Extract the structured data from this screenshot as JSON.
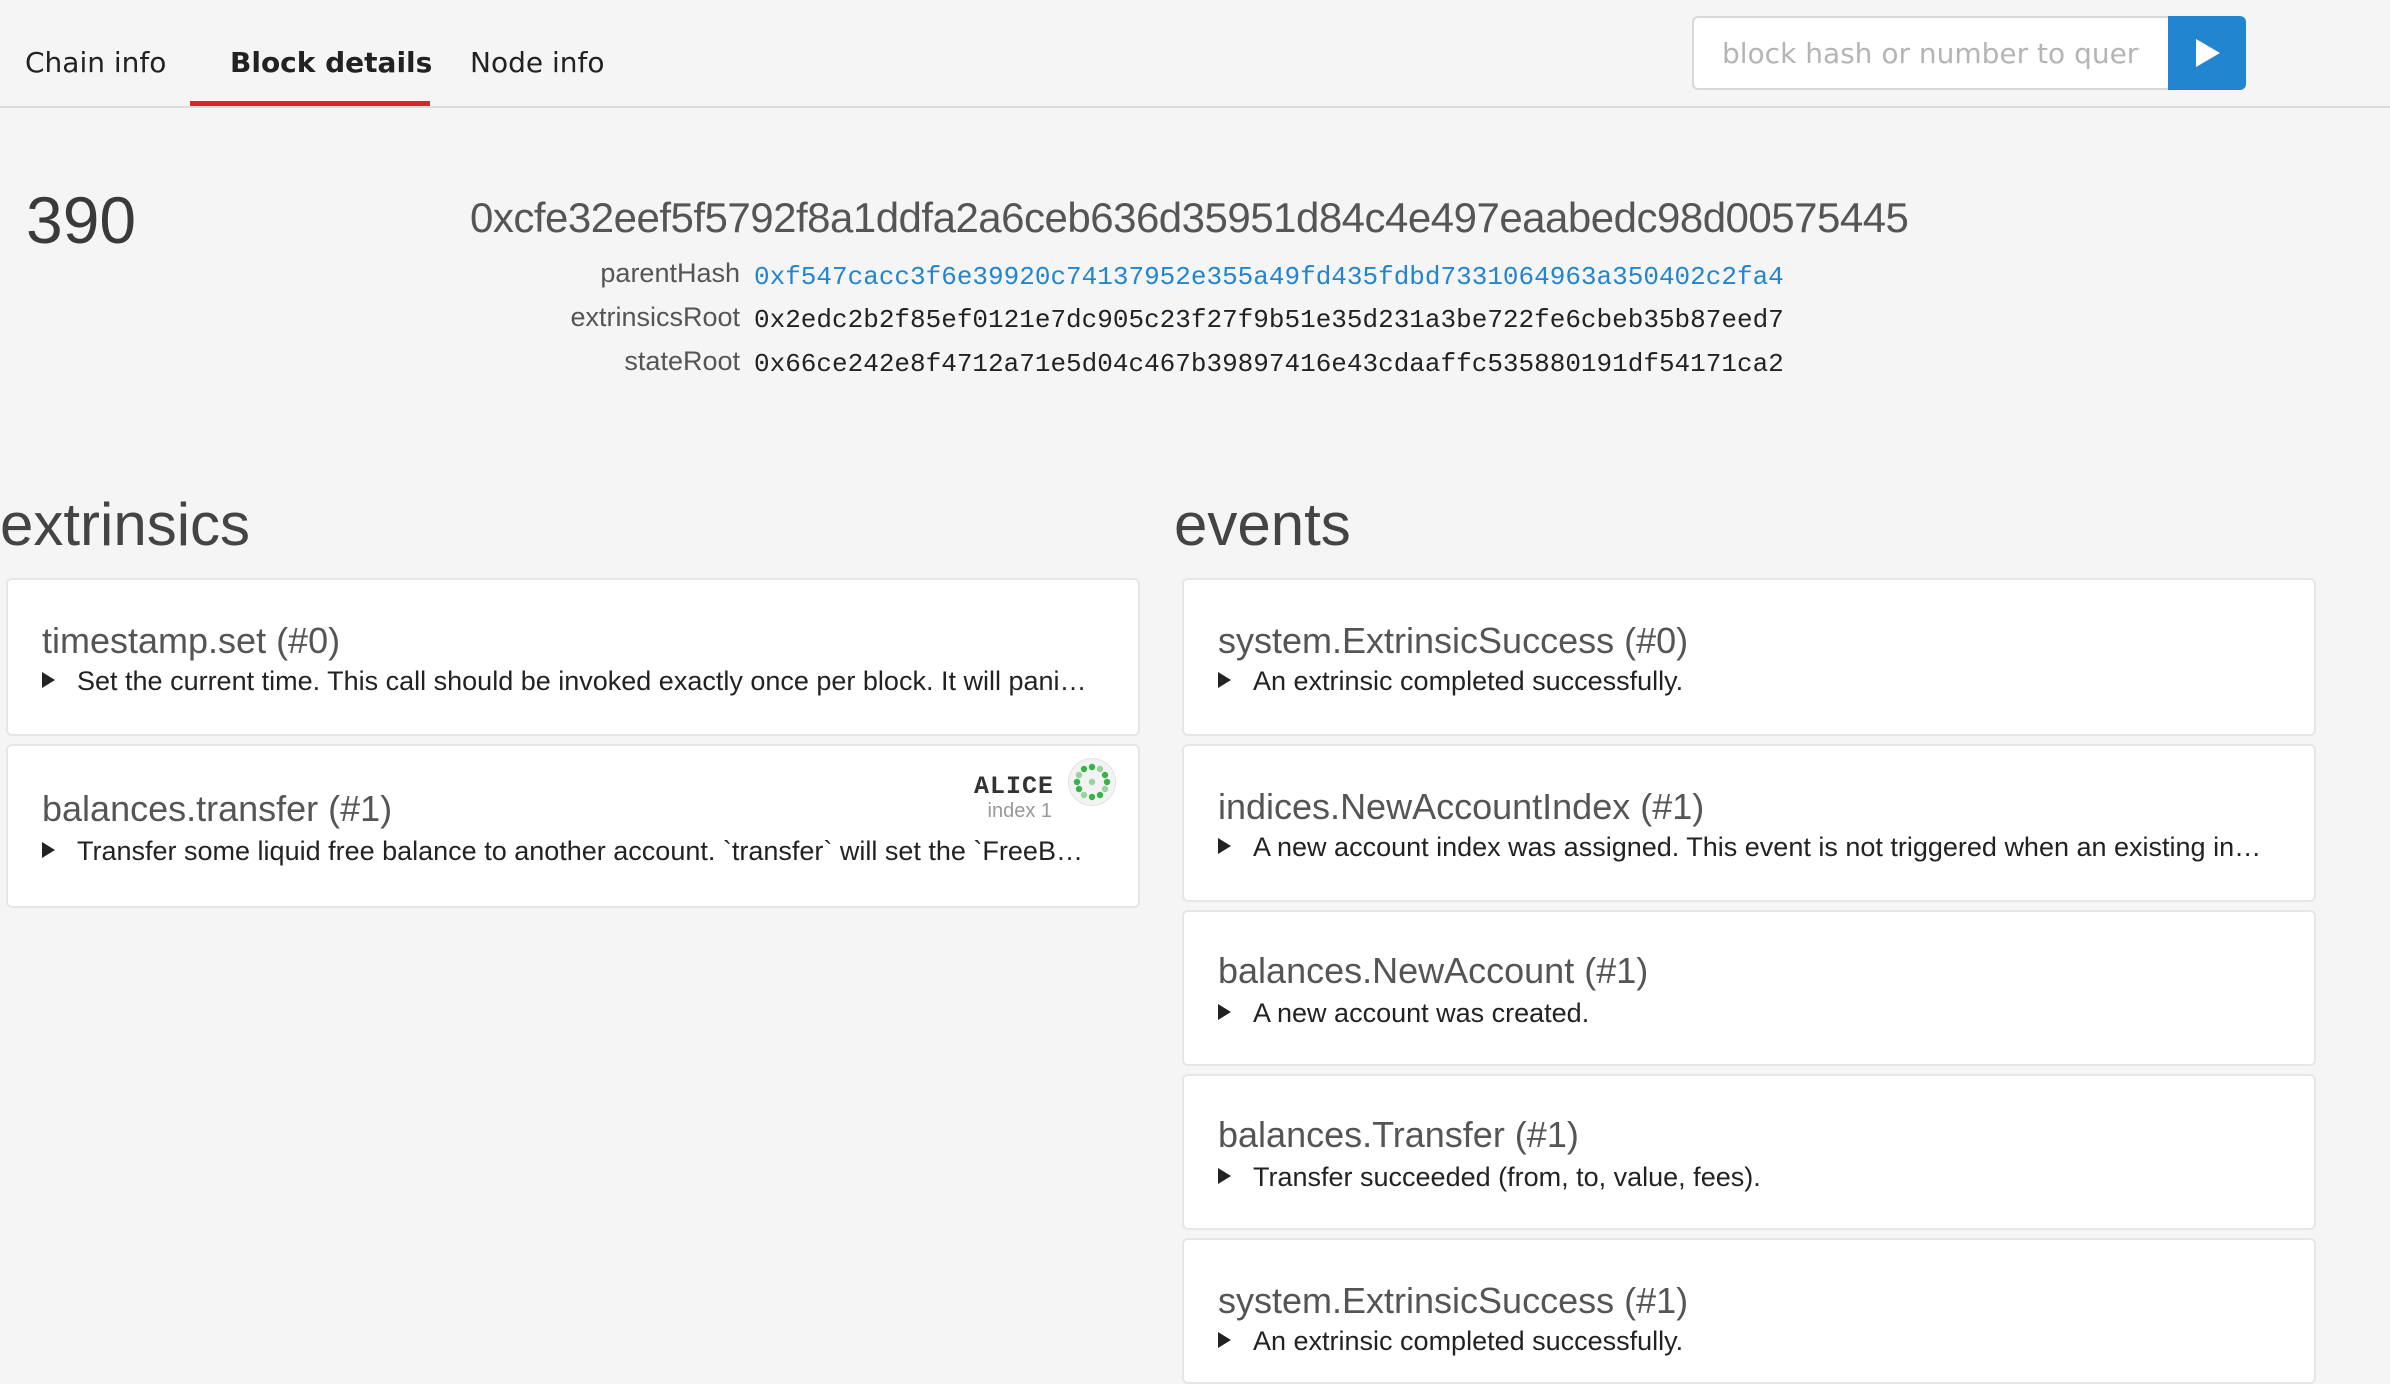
{
  "tabs": [
    {
      "label": "Chain info"
    },
    {
      "label": "Block details"
    },
    {
      "label": "Node info"
    }
  ],
  "search": {
    "placeholder": "block hash or number to query"
  },
  "colors": {
    "accent": "#2185d0",
    "active_tab": "#d9262c"
  },
  "block": {
    "number": "390",
    "hash": "0xcfe32eef5f5792f8a1ddfa2a6ceb636d35951d84c4e497eaabedc98d00575445",
    "fields": [
      {
        "label": "parentHash",
        "value": "0xf547cacc3f6e39920c74137952e355a49fd435fdbd7331064963a350402c2fa4",
        "link": true
      },
      {
        "label": "extrinsicsRoot",
        "value": "0x2edc2b2f85ef0121e7dc905c23f27f9b51e35d231a3be722fe6cbeb35b87eed7",
        "link": false
      },
      {
        "label": "stateRoot",
        "value": "0x66ce242e8f4712a71e5d04c467b39897416e43cdaaffc535880191df54171ca2",
        "link": false
      }
    ]
  },
  "extrinsics": {
    "title": "extrinsics",
    "items": [
      {
        "title": "timestamp.set (#0)",
        "desc": "Set the current time. This call should be invoked exactly once per block. It will panic at the finalization phase, if this call hasn't been invoked by that time."
      },
      {
        "title": "balances.transfer (#1)",
        "desc": "Transfer some liquid free balance to another account. `transfer` will set the `FreeBalance` of the sender and receiver.",
        "account": {
          "name": "ALICE",
          "index": "index 1"
        }
      }
    ]
  },
  "events": {
    "title": "events",
    "items": [
      {
        "title": "system.ExtrinsicSuccess (#0)",
        "desc": "An extrinsic completed successfully."
      },
      {
        "title": "indices.NewAccountIndex (#1)",
        "desc": "A new account index was assigned. This event is not triggered when an existing index is reassigned to another AccountId."
      },
      {
        "title": "balances.NewAccount (#1)",
        "desc": "A new account was created."
      },
      {
        "title": "balances.Transfer (#1)",
        "desc": "Transfer succeeded (from, to, value, fees)."
      },
      {
        "title": "system.ExtrinsicSuccess (#1)",
        "desc": "An extrinsic completed successfully."
      }
    ]
  }
}
